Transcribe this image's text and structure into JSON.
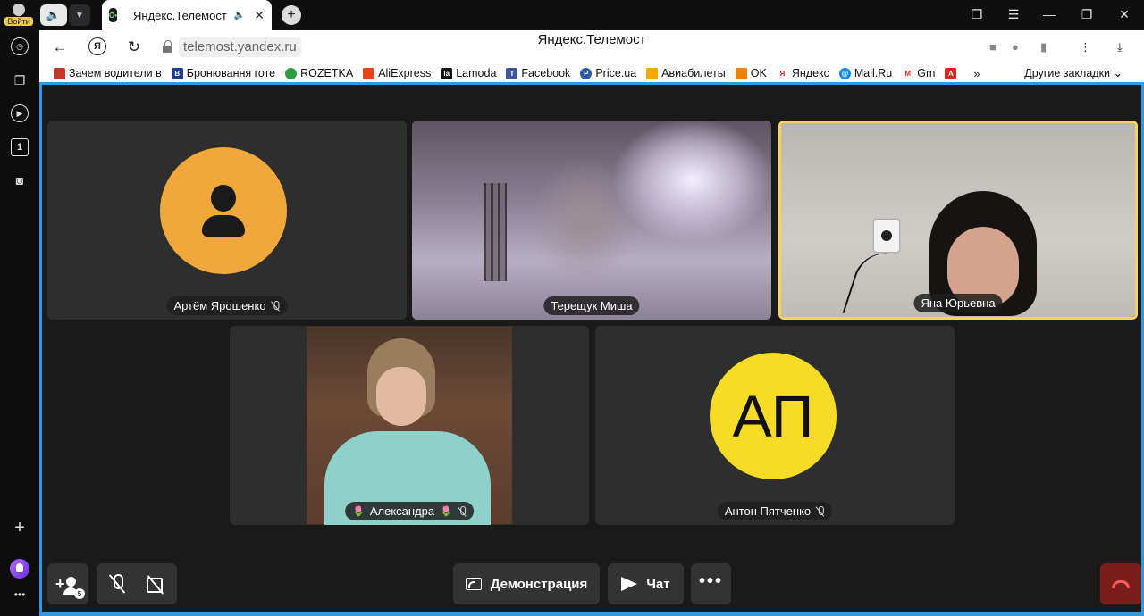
{
  "browser": {
    "login_label": "Войти",
    "tab": {
      "title": "Яндекс.Телемост",
      "favicon_text": "O•"
    },
    "address": {
      "url": "telemost.yandex.ru",
      "page_title": "Яндекс.Телемост"
    },
    "bookmarks": [
      {
        "label": "Зачем водители в",
        "icon_color": "#c0392b",
        "icon_text": ""
      },
      {
        "label": "Бронювання готе",
        "icon_color": "#1e3d8f",
        "icon_text": "B"
      },
      {
        "label": "ROZETKA",
        "icon_color": "#2e9e45",
        "icon_text": ""
      },
      {
        "label": "AliExpress",
        "icon_color": "#e8431e",
        "icon_text": ""
      },
      {
        "label": "Lamoda",
        "icon_color": "#111111",
        "icon_text": "la"
      },
      {
        "label": "Facebook",
        "icon_color": "#3b5998",
        "icon_text": "f"
      },
      {
        "label": "Price.ua",
        "icon_color": "#2b5aa8",
        "icon_text": "P"
      },
      {
        "label": "Авиабилеты",
        "icon_color": "#f2a900",
        "icon_text": ""
      },
      {
        "label": "OK",
        "icon_color": "#ee8208",
        "icon_text": ""
      },
      {
        "label": "Яндекс",
        "icon_color": "#ffffff",
        "icon_text": "Я"
      },
      {
        "label": "Mail.Ru",
        "icon_color": "#168de2",
        "icon_text": "@"
      },
      {
        "label": "Gm",
        "icon_color": "#ffffff",
        "icon_text": "M"
      },
      {
        "label": "",
        "icon_color": "#d6281f",
        "icon_text": "A"
      }
    ],
    "bookmarks_more": "»",
    "other_bookmarks": "Другие закладки",
    "accent_color": "#2f9ae0"
  },
  "call": {
    "participants": [
      {
        "name": "Артём Ярошенко",
        "muted": true,
        "avatar": "generic"
      },
      {
        "name": "Терещук Миша",
        "muted": false,
        "avatar": "video"
      },
      {
        "name": "Яна Юрьевна",
        "muted": false,
        "avatar": "video",
        "active_speaker": true
      },
      {
        "name": "Александра",
        "muted": true,
        "avatar": "video"
      },
      {
        "name": "Антон Пятченко",
        "muted": true,
        "avatar": "initials",
        "initials": "АП"
      }
    ],
    "controls": {
      "participants_count": "5",
      "screen_share_label": "Демонстрация",
      "chat_label": "Чат",
      "more_label": "•••"
    },
    "colors": {
      "avatar_orange": "#f1a83b",
      "avatar_yellow": "#f7dc27",
      "active_border": "#f7d35b",
      "hangup": "#7a1d1d"
    }
  }
}
